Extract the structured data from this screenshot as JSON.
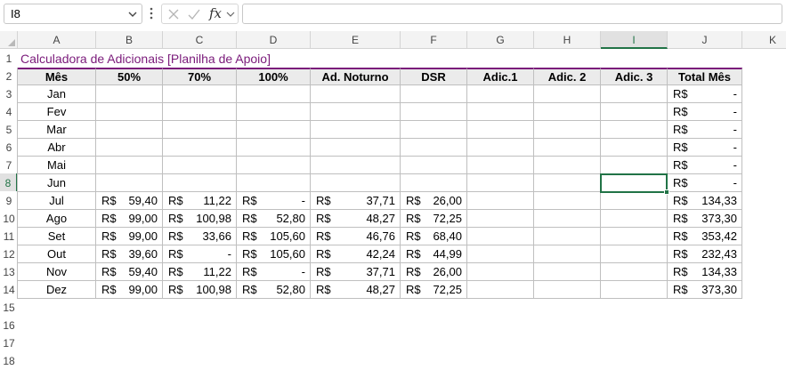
{
  "formula_bar": {
    "name_box": "I8",
    "fx_label": "fx",
    "formula": ""
  },
  "columns": [
    "A",
    "B",
    "C",
    "D",
    "E",
    "F",
    "G",
    "H",
    "I",
    "J",
    "K"
  ],
  "selected_column": "I",
  "rows": [
    "1",
    "2",
    "3",
    "4",
    "5",
    "6",
    "7",
    "8",
    "9",
    "10",
    "11",
    "12",
    "13",
    "14",
    "15",
    "16",
    "17",
    "18"
  ],
  "selected_row": "8",
  "title": "Calculadora de Adicionais [Planilha de Apoio]",
  "table_headers": [
    "Mês",
    "50%",
    "70%",
    "100%",
    "Ad. Noturno",
    "DSR",
    "Adic.1",
    "Adic. 2",
    "Adic. 3",
    "Total Mês"
  ],
  "currency": "R$",
  "table_rows": [
    {
      "mes": "Jan",
      "v50": "",
      "v70": "",
      "v100": "",
      "noturno": "",
      "dsr": "",
      "total": "-"
    },
    {
      "mes": "Fev",
      "v50": "",
      "v70": "",
      "v100": "",
      "noturno": "",
      "dsr": "",
      "total": "-"
    },
    {
      "mes": "Mar",
      "v50": "",
      "v70": "",
      "v100": "",
      "noturno": "",
      "dsr": "",
      "total": "-"
    },
    {
      "mes": "Abr",
      "v50": "",
      "v70": "",
      "v100": "",
      "noturno": "",
      "dsr": "",
      "total": "-"
    },
    {
      "mes": "Mai",
      "v50": "",
      "v70": "",
      "v100": "",
      "noturno": "",
      "dsr": "",
      "total": "-"
    },
    {
      "mes": "Jun",
      "v50": "",
      "v70": "",
      "v100": "",
      "noturno": "",
      "dsr": "",
      "total": "-"
    },
    {
      "mes": "Jul",
      "v50": "59,40",
      "v70": "11,22",
      "v100": "-",
      "noturno": "37,71",
      "dsr": "26,00",
      "total": "134,33"
    },
    {
      "mes": "Ago",
      "v50": "99,00",
      "v70": "100,98",
      "v100": "52,80",
      "noturno": "48,27",
      "dsr": "72,25",
      "total": "373,30"
    },
    {
      "mes": "Set",
      "v50": "99,00",
      "v70": "33,66",
      "v100": "105,60",
      "noturno": "46,76",
      "dsr": "68,40",
      "total": "353,42"
    },
    {
      "mes": "Out",
      "v50": "39,60",
      "v70": "-",
      "v100": "105,60",
      "noturno": "42,24",
      "dsr": "44,99",
      "total": "232,43"
    },
    {
      "mes": "Nov",
      "v50": "59,40",
      "v70": "11,22",
      "v100": "-",
      "noturno": "37,71",
      "dsr": "26,00",
      "total": "134,33"
    },
    {
      "mes": "Dez",
      "v50": "99,00",
      "v70": "100,98",
      "v100": "52,80",
      "noturno": "48,27",
      "dsr": "72,25",
      "total": "373,30"
    }
  ],
  "colors": {
    "title": "#7a1a7a",
    "header_bg": "#ebebeb",
    "selection": "#217346"
  }
}
